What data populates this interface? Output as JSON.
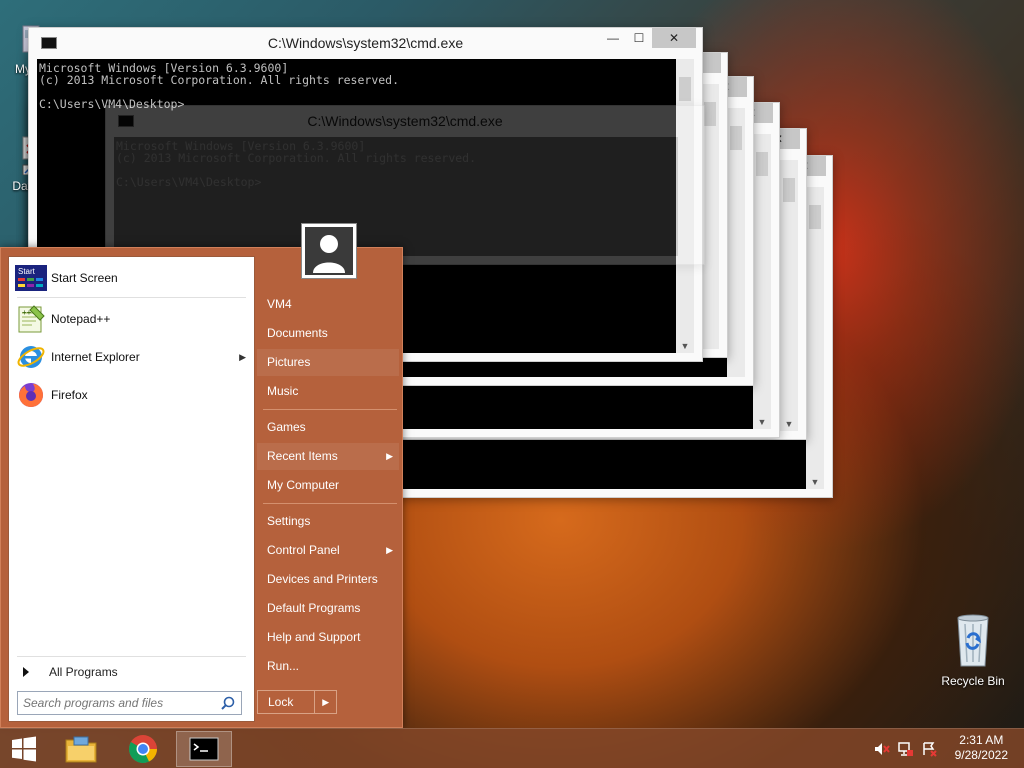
{
  "desktop": {
    "icons": [
      {
        "label": "My C"
      },
      {
        "label": "Data"
      },
      {
        "label": "Recycle Bin"
      }
    ]
  },
  "cmd_windows": {
    "title": "C:\\Windows\\system32\\cmd.exe",
    "line1": "Microsoft Windows [Version 6.3.9600]",
    "line2": "(c) 2013 Microsoft Corporation. All rights reserved.",
    "line3": "C:\\Users\\VM4\\Desktop>",
    "minimize": "—",
    "maximize": "☐",
    "close": "✕"
  },
  "start_menu": {
    "left_items": [
      {
        "label": "Start Screen",
        "icon": "start-screen-icon"
      },
      {
        "label": "Notepad++",
        "icon": "notepad-plus-plus-icon"
      },
      {
        "label": "Internet Explorer",
        "icon": "internet-explorer-icon"
      },
      {
        "label": "Firefox",
        "icon": "firefox-icon"
      }
    ],
    "start_icon_text": "Start",
    "all_programs": "All Programs",
    "search_placeholder": "Search programs and files",
    "right_items": [
      {
        "label": "VM4"
      },
      {
        "label": "Documents"
      },
      {
        "label": "Pictures"
      },
      {
        "label": "Music"
      },
      {
        "label": "Games"
      },
      {
        "label": "Recent Items"
      },
      {
        "label": "My Computer"
      },
      {
        "label": "Settings"
      },
      {
        "label": "Control Panel"
      },
      {
        "label": "Devices and Printers"
      },
      {
        "label": "Default Programs"
      },
      {
        "label": "Help and Support"
      },
      {
        "label": "Run..."
      }
    ],
    "lock": "Lock",
    "colors": {
      "accent": "#b5613c",
      "panel": "#ffffff"
    }
  },
  "taskbar": {
    "apps": [
      {
        "icon": "windows-start-icon"
      },
      {
        "icon": "file-explorer-icon"
      },
      {
        "icon": "chrome-icon"
      },
      {
        "icon": "cmd-icon"
      }
    ],
    "tray": {
      "icons": [
        "volume-muted-icon",
        "network-icon",
        "action-center-icon"
      ],
      "time": "2:31 AM",
      "date": "9/28/2022"
    }
  }
}
